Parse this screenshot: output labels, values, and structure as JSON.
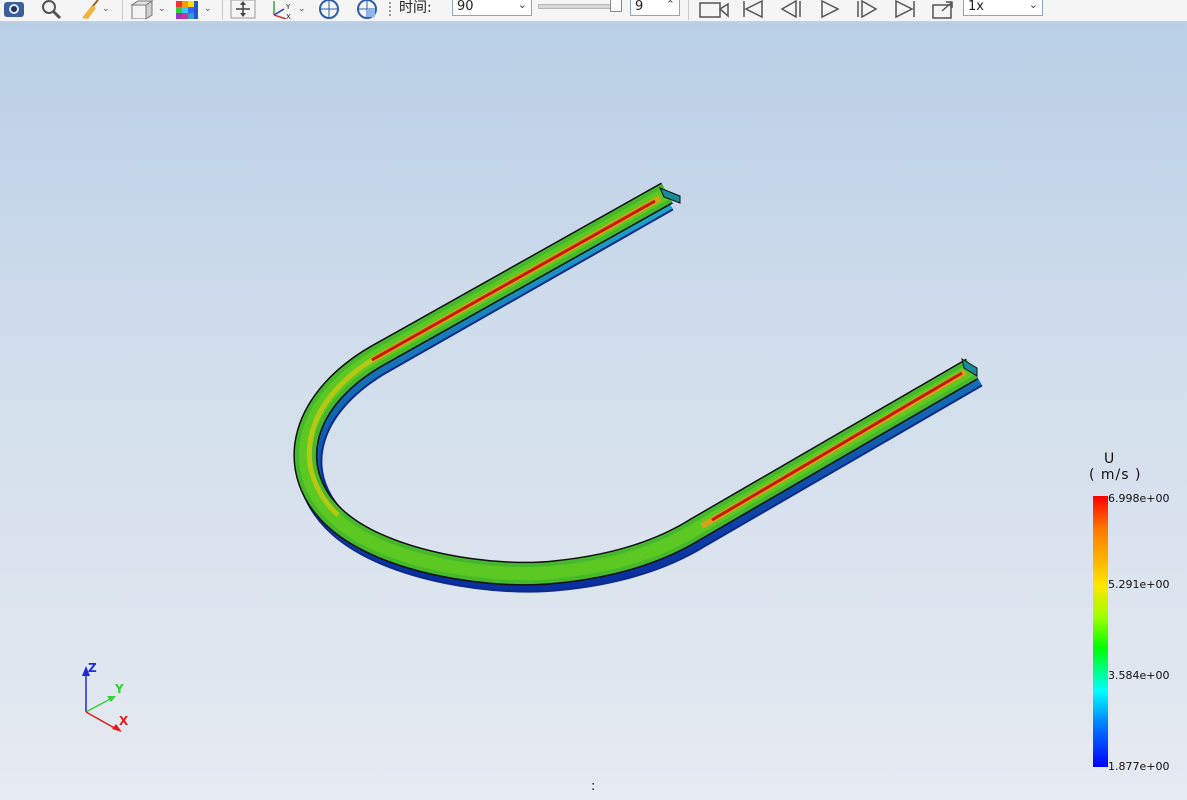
{
  "toolbar": {
    "time_label": "时间:",
    "time_value": "90",
    "step_value": "9",
    "speed_value": "1x"
  },
  "legend": {
    "field": "U",
    "unit": "( m/s )",
    "max": "6.998e+00",
    "t1": "5.291e+00",
    "t2": "3.584e+00",
    "min": "1.877e+00",
    "colors": {
      "max": "#ff0000",
      "mid": "#00ff00",
      "min": "#0000ff"
    }
  },
  "axes": {
    "x": "X",
    "y": "Y",
    "z": "Z"
  },
  "status": {
    "text": ":"
  }
}
